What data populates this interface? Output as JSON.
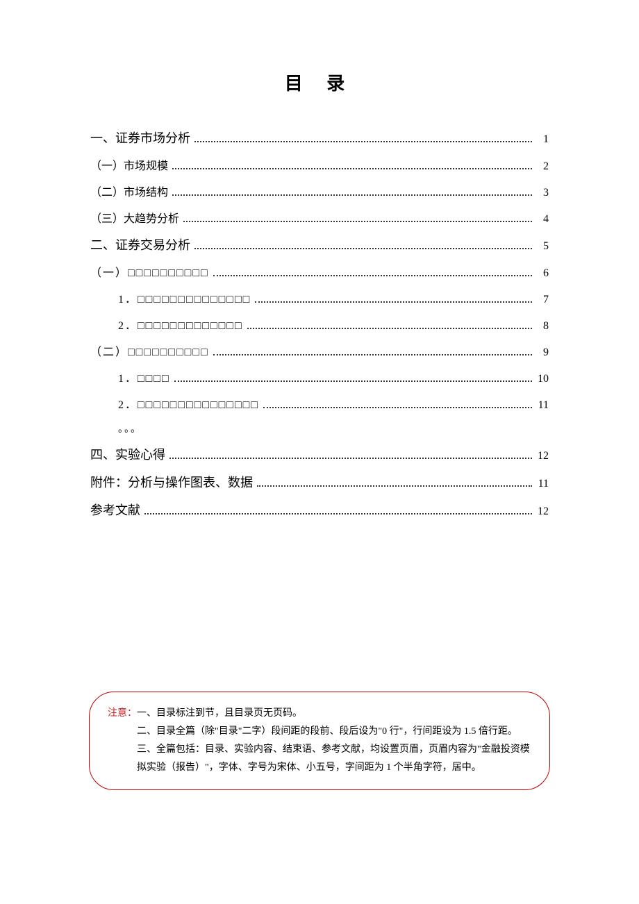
{
  "title": "目 录",
  "toc": [
    {
      "level": 1,
      "label": "一、证券市场分析",
      "page": "1"
    },
    {
      "level": 2,
      "label": "（一）市场规模",
      "page": "2"
    },
    {
      "level": 2,
      "label": "（二）市场结构",
      "page": "3"
    },
    {
      "level": 2,
      "label": "（三）大趋势分析",
      "page": "4"
    },
    {
      "level": 1,
      "label": "二、证券交易分析",
      "page": "5"
    },
    {
      "level": 2,
      "label": "（一）□□□□□□□□□□",
      "page": "6"
    },
    {
      "level": 3,
      "label": "1．□□□□□□□□□□□□□□",
      "page": "7"
    },
    {
      "level": 3,
      "label": "2．□□□□□□□□□□□□□",
      "page": "8"
    },
    {
      "level": 2,
      "label": "（二）□□□□□□□□□□",
      "page": "9"
    },
    {
      "level": 3,
      "label": "1．□□□□",
      "page": "10"
    },
    {
      "level": 3,
      "label": "2．□□□□□□□□□□□□□□□",
      "page": "11"
    },
    {
      "level": 0,
      "ellipsis": "。。。"
    },
    {
      "level": 1,
      "label": "四、实验心得",
      "page": "12"
    },
    {
      "level": 1,
      "label": "附件：分析与操作图表、数据",
      "page": "11"
    },
    {
      "level": 1,
      "label": "参考文献",
      "page": "12"
    }
  ],
  "note": {
    "lead": "注意：",
    "lines": [
      "一、目录标注到节，且目录页无页码。",
      "二、目录全篇（除\"目录\"二字）段间距的段前、段后设为\"0 行\"，行间距设为 1.5 倍行距。",
      "三、全篇包括：目录、实验内容、结束语、参考文献，均设置页眉，页眉内容为\"金融投资模拟实验（报告）\"，字体、字号为宋体、小五号，字间距为 1 个半角字符，居中。"
    ]
  }
}
